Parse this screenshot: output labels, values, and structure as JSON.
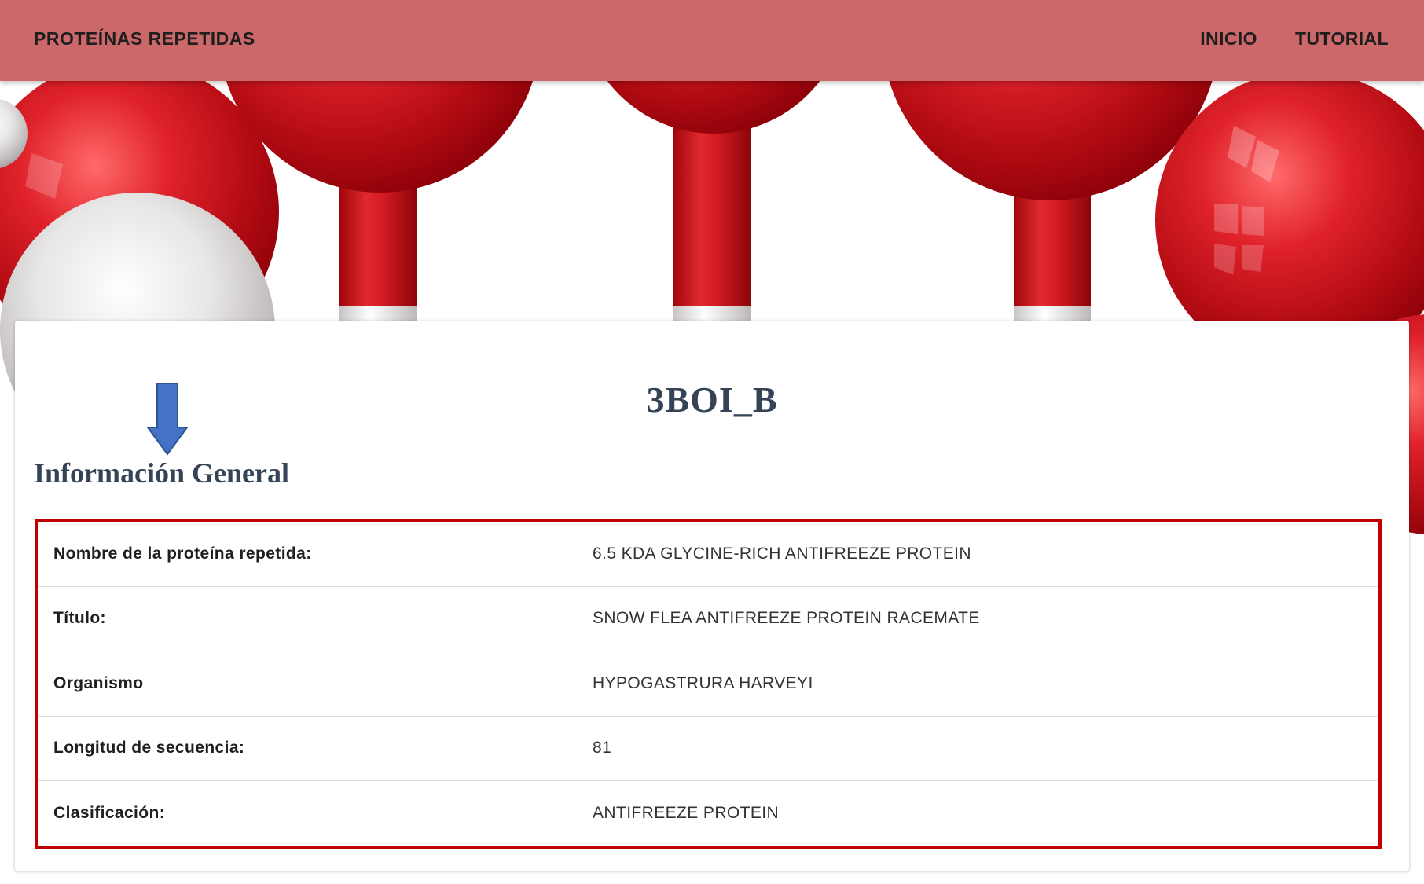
{
  "navbar": {
    "brand": "PROTEÍNAS REPETIDAS",
    "links": [
      "INICIO",
      "TUTORIAL"
    ]
  },
  "protein": {
    "id": "3BOI_B"
  },
  "section": {
    "title": "Información General"
  },
  "info_rows": [
    {
      "label": "Nombre de la proteína repetida:",
      "value": "6.5 KDA GLYCINE-RICH ANTIFREEZE PROTEIN"
    },
    {
      "label": "Título:",
      "value": "SNOW FLEA ANTIFREEZE PROTEIN RACEMATE"
    },
    {
      "label": "Organismo",
      "value": "HYPOGASTRURA HARVEYI"
    },
    {
      "label": "Longitud de secuencia:",
      "value": "81"
    },
    {
      "label": "Clasificación:",
      "value": "ANTIFREEZE PROTEIN"
    }
  ],
  "colors": {
    "navbar": "#cc6869",
    "title_text": "#344356",
    "highlight_border": "#c00000",
    "annotation_arrow": "#4472c4",
    "molecule_red": "#c0111a",
    "molecule_white": "#dcdcdc"
  },
  "icons": {
    "annotation": "arrow-down-icon",
    "hero": "molecule-illustration"
  }
}
